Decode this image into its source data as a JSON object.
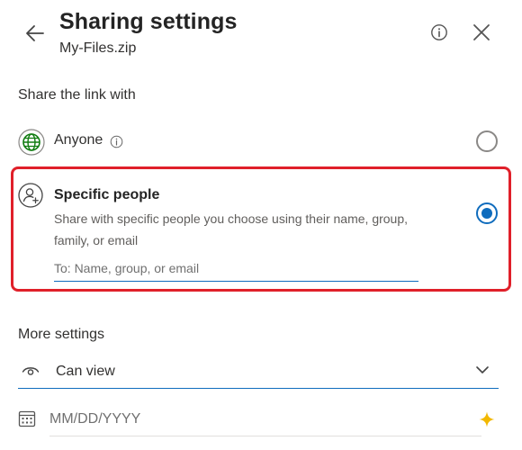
{
  "header": {
    "title": "Sharing settings",
    "file_name": "My-Files.zip"
  },
  "share_section": {
    "heading": "Share the link with",
    "options": [
      {
        "label": "Anyone",
        "selected": false
      },
      {
        "label": "Specific people",
        "description": "Share with specific people you choose using their name, group, family, or email",
        "recipients_placeholder": "To: Name, group, or email",
        "selected": true
      }
    ]
  },
  "more_settings": {
    "heading": "More settings",
    "permission_value": "Can view",
    "expiry_placeholder": "MM/DD/YYYY"
  },
  "icons": {
    "back": "back-arrow-icon",
    "info": "info-icon",
    "close": "close-icon",
    "anyone": "globe-icon",
    "specific": "person-add-icon",
    "permission": "eye-icon",
    "dropdown": "chevron-down-icon",
    "date": "calendar-icon",
    "premium": "sparkle-icon"
  },
  "colors": {
    "accent": "#0f6cbd",
    "highlight_border": "#e0202a",
    "globe": "#107c10",
    "premium": "#f2b800"
  }
}
